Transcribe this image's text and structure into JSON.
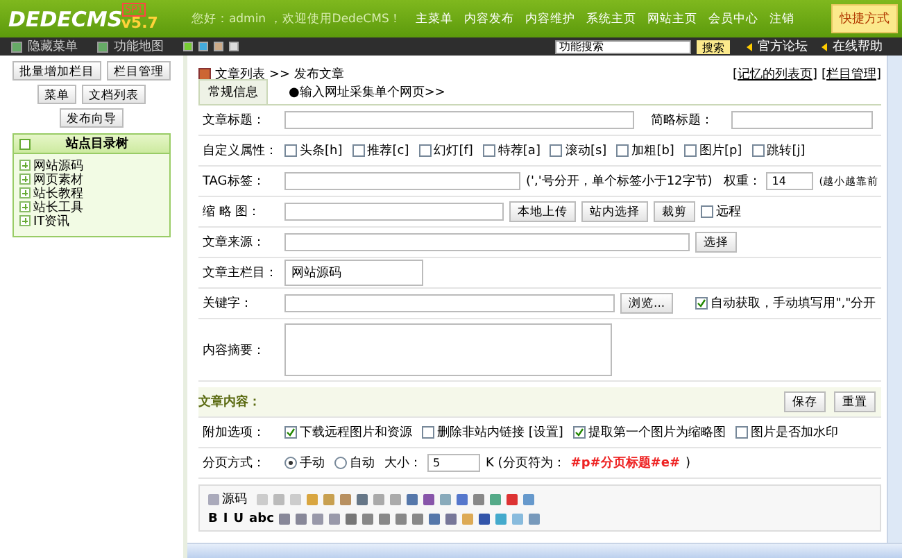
{
  "logo": {
    "name": "DEDECMS",
    "badge": "SP1",
    "version": "v5.7"
  },
  "header": {
    "welcome": "您好：admin ，欢迎使用DedeCMS！",
    "nav": [
      "主菜单",
      "内容发布",
      "内容维护",
      "系统主页",
      "网站主页",
      "会员中心",
      "注销"
    ],
    "shortcut": "快捷方式"
  },
  "toolbar": {
    "items": [
      "隐藏菜单",
      "功能地图"
    ],
    "search": {
      "value": "功能搜索",
      "button": "搜索"
    },
    "links": [
      "官方论坛",
      "在线帮助"
    ]
  },
  "sidebar": {
    "buttons": [
      "批量增加栏目",
      "栏目管理",
      "菜单",
      "文档列表",
      "发布向导"
    ],
    "tree": {
      "title": "站点目录树",
      "items": [
        {
          "label": "网站源码",
          "expanded": false
        },
        {
          "label": "网页素材",
          "expanded": false
        },
        {
          "label": "站长教程",
          "expanded": false
        },
        {
          "label": "站长工具",
          "expanded": false
        },
        {
          "label": "IT资讯",
          "expanded": false
        }
      ]
    }
  },
  "main": {
    "breadcrumb": {
      "link": "文章列表",
      "current": ">> 发布文章"
    },
    "links": [
      "[记忆的列表页]",
      "[栏目管理]"
    ],
    "tabs": [
      {
        "label": "常规信息",
        "selected": true
      },
      {
        "label": "●输入网址采集单个网页>>",
        "selected": false
      }
    ],
    "rows": [
      {
        "kind": "title",
        "label": "文章标题：",
        "label2": "简略标题："
      },
      {
        "kind": "checks",
        "label": "自定义属性：",
        "options": [
          {
            "label": "头条[h]",
            "checked": false
          },
          {
            "label": "推荐[c]",
            "checked": false
          },
          {
            "label": "幻灯[f]",
            "checked": false
          },
          {
            "label": "特荐[a]",
            "checked": false
          },
          {
            "label": "滚动[s]",
            "checked": false
          },
          {
            "label": "加粗[b]",
            "checked": false
          },
          {
            "label": "图片[p]",
            "checked": false
          },
          {
            "label": "跳转[j]",
            "checked": false
          }
        ]
      },
      {
        "kind": "tag",
        "label": "TAG标签：",
        "hint": "(','号分开，单个标签小于12字节)",
        "label2": "权重：",
        "value2": "14",
        "hint2": "(越小越靠前"
      },
      {
        "kind": "thumb",
        "label": "缩 略 图：",
        "buttons": [
          "本地上传",
          "站内选择",
          "裁剪"
        ],
        "check": {
          "label": "远程",
          "checked": false
        }
      },
      {
        "kind": "source",
        "label": "文章来源：",
        "button": "选择"
      },
      {
        "kind": "column",
        "label": "文章主栏目：",
        "value": "网站源码"
      },
      {
        "kind": "keywords",
        "label": "关键字：",
        "button": "浏览...",
        "check": {
          "label": "自动获取，手动填写用\",\"分开",
          "checked": true
        }
      },
      {
        "kind": "summary",
        "label": "内容摘要："
      }
    ],
    "content": {
      "label": "文章内容：",
      "buttons": [
        "保存",
        "重置"
      ]
    },
    "extras": {
      "label": "附加选项：",
      "options": [
        {
          "label": "下载远程图片和资源",
          "checked": true
        },
        {
          "label": "删除非站内链接 [设置]",
          "checked": false
        },
        {
          "label": "提取第一个图片为缩略图",
          "checked": true
        },
        {
          "label": "图片是否加水印",
          "checked": false
        }
      ]
    },
    "paging": {
      "label": "分页方式：",
      "options": [
        {
          "label": "手动",
          "selected": true
        },
        {
          "label": "自动",
          "selected": false
        }
      ],
      "size_label": "大小：",
      "size": "5",
      "unit": "K (分页符为：",
      "marker": "#p#分页标题#e#",
      "close": ")"
    },
    "editor": {
      "source": "源码",
      "format": [
        "B",
        "I",
        "U",
        "abc"
      ]
    }
  }
}
